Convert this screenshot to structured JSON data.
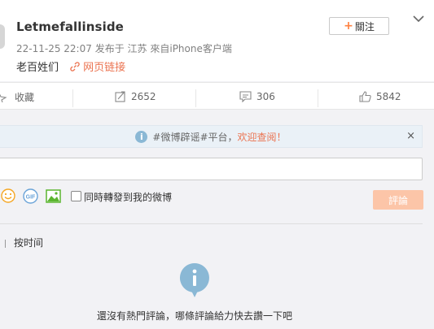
{
  "post": {
    "username": "Letmefallinside",
    "timestamp": "22-11-25 22:07",
    "location": "发布于 江苏",
    "source": "來自iPhone客户端",
    "text": "老百姓们",
    "link_label": "网页链接",
    "follow_label": "關注",
    "follow_plus": "+"
  },
  "actions": {
    "favorite_label": "收藏",
    "repost_count": "2652",
    "comment_count": "306",
    "like_count": "5842"
  },
  "notice": {
    "info_glyph": "i",
    "text": "#微博辟谣#平台，",
    "welcome": "欢迎查阅！",
    "close_glyph": "×"
  },
  "composer": {
    "input_value": "",
    "repost_label": "同時轉發到我的微博",
    "submit_label": "評論",
    "gif_label": "GIF"
  },
  "comments": {
    "sort_label": "按时间",
    "empty_text": "還沒有熱門評論，哪條評論給力快去讚一下吧"
  },
  "colors": {
    "accent": "#eb7350",
    "submit_disabled": "#fcc5a8",
    "info_blue": "#8ab8d5"
  },
  "icons": [
    "chevron-down-icon",
    "link-icon",
    "star-icon",
    "repost-icon",
    "comment-icon",
    "like-icon",
    "info-icon",
    "close-icon",
    "emoji-icon",
    "gif-icon",
    "image-icon",
    "empty-info-icon"
  ]
}
